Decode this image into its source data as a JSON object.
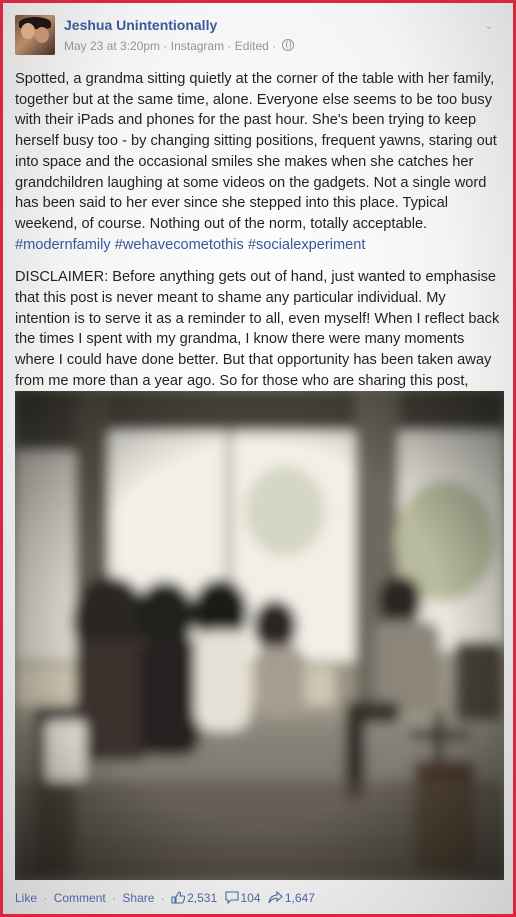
{
  "post": {
    "author": "Jeshua Unintentionally",
    "date": "May 23 at 3:20pm",
    "source": "Instagram",
    "edited": "Edited",
    "meta_sep": " · ",
    "paragraph1": "Spotted, a grandma sitting quietly at the corner of the table with her family, together but at the same time, alone. Everyone else seems to be too busy with their iPads and phones for the past hour. She's been trying to keep herself busy too - by changing sitting positions, frequent yawns, staring out into space and the occasional smiles she makes when she catches her grandchildren laughing at some videos on the gadgets. Not a single word has been said to her ever since she stepped into this place. Typical weekend, of course. Nothing out of the norm, totally acceptable.",
    "hashtags": [
      "#modernfamily",
      "#wehavecometothis",
      "#socialexperiment"
    ],
    "paragraph2": "DISCLAIMER: Before anything gets out of hand, just wanted to emphasise that this post is never meant to shame any particular individual. My intention is to serve it as a reminder to all, even myself! When I reflect back the times I spent with my grandma, I know there were many moments where I could have done better. But that opportunity has been taken away from me more than a year ago. So for those who are sharing this post, please share it with good intentions",
    "emoji_icon": "smile-icon"
  },
  "actions": {
    "like": "Like",
    "comment": "Comment",
    "share": "Share",
    "sep": "·",
    "likes_count": "2,531",
    "comments_count": "104",
    "shares_count": "1,647"
  },
  "icons": {
    "options": "chevron-down-icon",
    "privacy": "globe-icon",
    "likes": "thumbs-up-icon",
    "comments": "comment-icon",
    "shares": "share-icon"
  },
  "colors": {
    "frame_border": "#d8283f",
    "link_blue": "#3b5998",
    "meta_gray": "#90949c",
    "text": "#1d2129"
  }
}
